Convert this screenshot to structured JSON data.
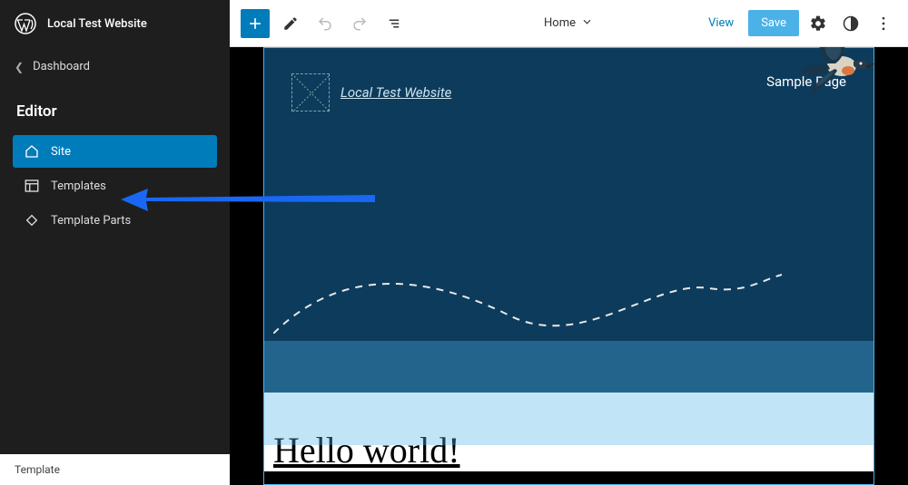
{
  "sidebar": {
    "site_title": "Local Test Website",
    "back_label": "Dashboard",
    "heading": "Editor",
    "items": [
      {
        "label": "Site",
        "icon": "home-icon",
        "active": true
      },
      {
        "label": "Templates",
        "icon": "layout-icon",
        "active": false
      },
      {
        "label": "Template Parts",
        "icon": "diamond-icon",
        "active": false
      }
    ],
    "footer": "Template"
  },
  "toolbar": {
    "current_template": "Home",
    "view_label": "View",
    "save_label": "Save"
  },
  "preview": {
    "site_link": "Local Test Website",
    "menu_item": "Sample Page",
    "post_title": "Hello world!"
  },
  "colors": {
    "accent": "#007cba",
    "hero_bg": "#0d3b5c",
    "annotation": "#1967f2"
  }
}
